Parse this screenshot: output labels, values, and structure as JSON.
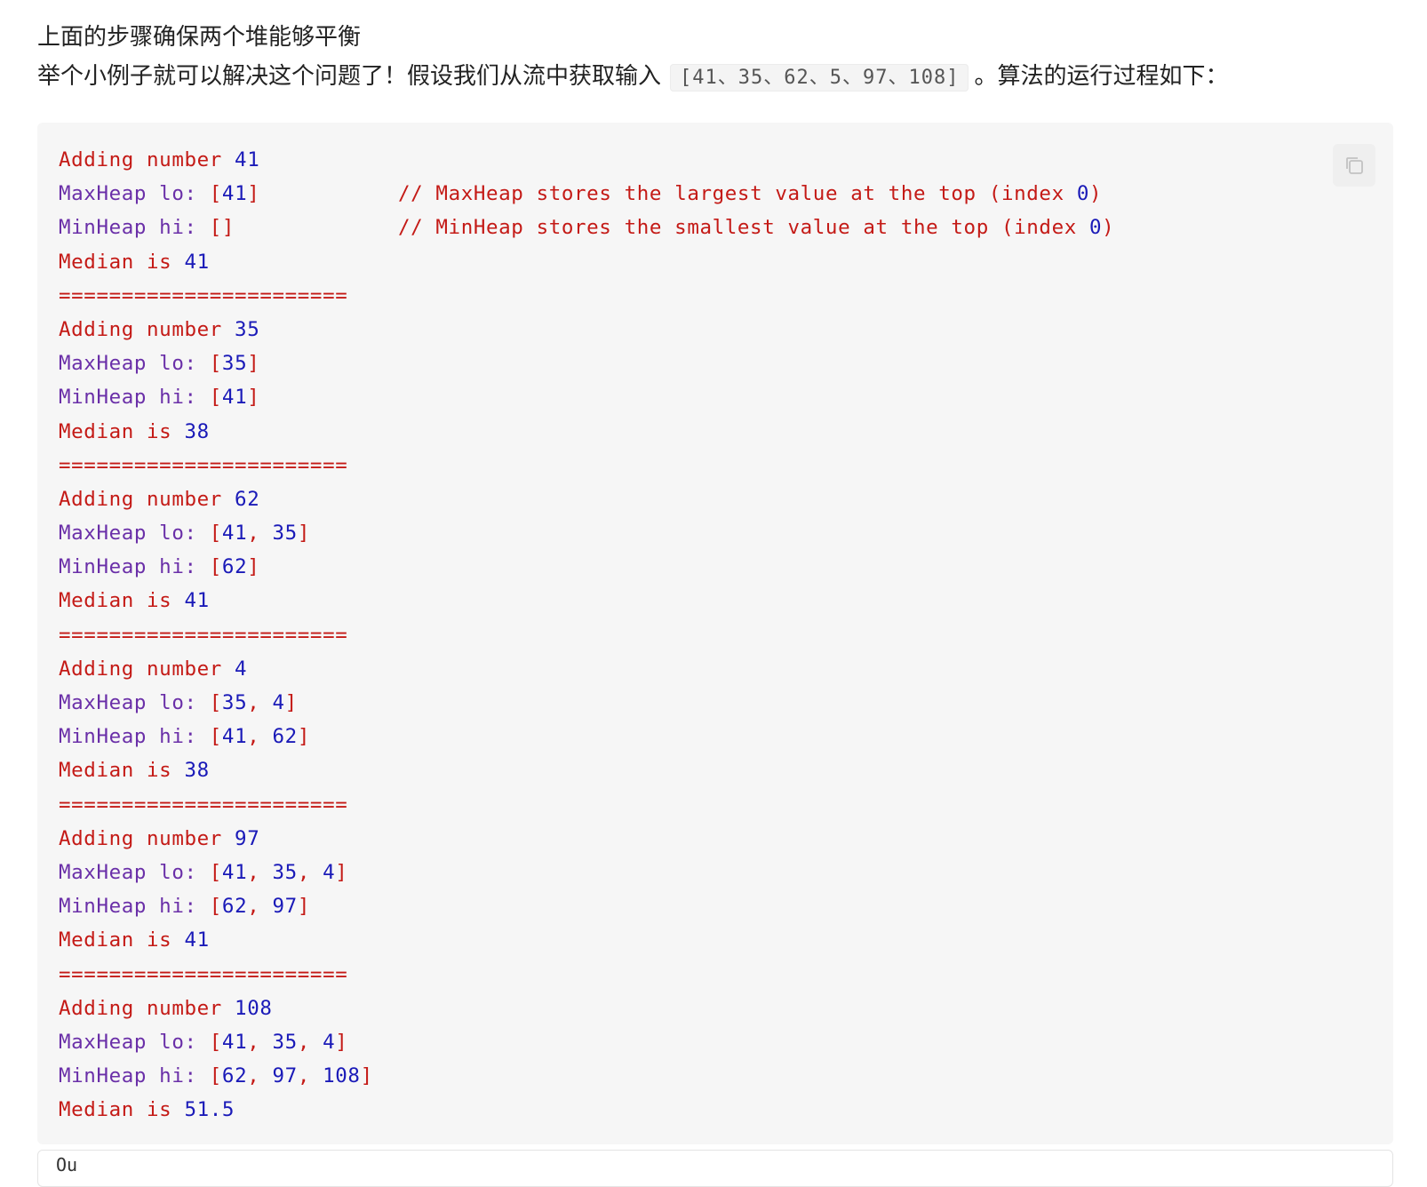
{
  "intro": {
    "line1": "上面的步骤确保两个堆能够平衡",
    "line2_before": "举个小例子就可以解决这个问题了！假设我们从流中获取输入",
    "line2_code": "[41、35、62、5、97、108]",
    "line2_after": "。算法的运行过程如下："
  },
  "code_block": {
    "copy_icon": "copy-icon",
    "comments": {
      "maxheap": "// MaxHeap stores the largest value at the top (index 0)",
      "minheap": "// MinHeap stores the smallest value at the top (index 0)"
    },
    "separator": "=======================",
    "steps": [
      {
        "add": "Adding number 41",
        "max": "MaxHeap lo: [41]",
        "min": "MinHeap hi: []",
        "median": "Median is 41"
      },
      {
        "add": "Adding number 35",
        "max": "MaxHeap lo: [35]",
        "min": "MinHeap hi: [41]",
        "median": "Median is 38"
      },
      {
        "add": "Adding number 62",
        "max": "MaxHeap lo: [41, 35]",
        "min": "MinHeap hi: [62]",
        "median": "Median is 41"
      },
      {
        "add": "Adding number 4",
        "max": "MaxHeap lo: [35, 4]",
        "min": "MinHeap hi: [41, 62]",
        "median": "Median is 38"
      },
      {
        "add": "Adding number 97",
        "max": "MaxHeap lo: [41, 35, 4]",
        "min": "MinHeap hi: [62, 97]",
        "median": "Median is 41"
      },
      {
        "add": "Adding number 108",
        "max": "MaxHeap lo: [41, 35, 4]",
        "min": "MinHeap hi: [62, 97, 108]",
        "median": "Median is 51.5"
      }
    ]
  },
  "next_block": {
    "partial_text": "Ou"
  },
  "colors": {
    "keyword_red": "#c41a16",
    "number_blue": "#1a1ab8",
    "label_purple": "#6a2fa8",
    "code_bg": "#f6f6f6"
  }
}
